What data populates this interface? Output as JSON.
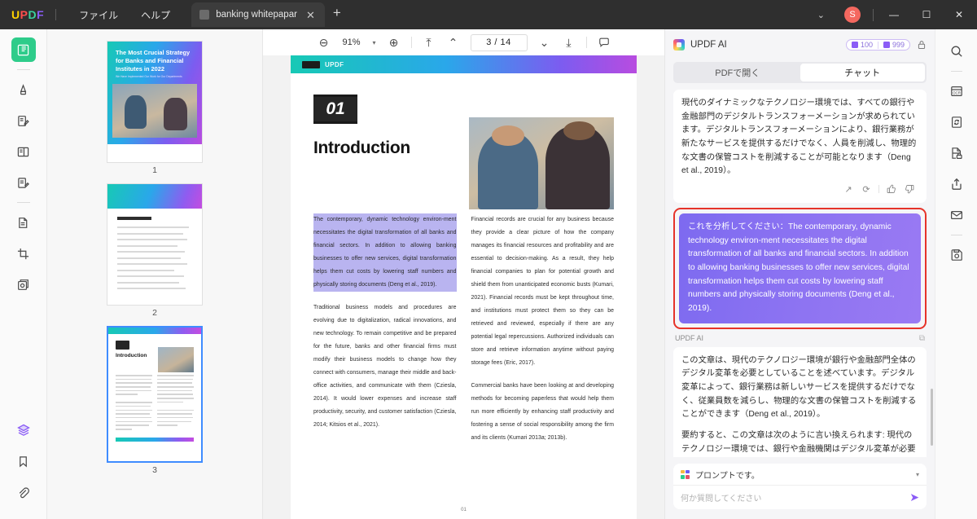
{
  "titlebar": {
    "logo": "UPDF",
    "menus": [
      "ファイル",
      "ヘルプ"
    ],
    "tab_title": "banking whitepapar",
    "tab_close": "✕",
    "new_tab": "+",
    "chevron": "⌄",
    "avatar": "S",
    "minimize": "—",
    "maximize": "☐",
    "close": "✕"
  },
  "sidebar": {
    "items": [
      {
        "name": "thumbnail-view-icon",
        "active": true
      },
      {
        "name": "highlighter-icon",
        "active": false
      },
      {
        "name": "annotate-icon",
        "active": false
      },
      {
        "name": "reading-mode-icon",
        "active": false
      },
      {
        "name": "edit-pdf-icon",
        "active": false
      },
      {
        "name": "page-organize-icon",
        "active": false
      },
      {
        "name": "crop-page-icon",
        "active": false
      },
      {
        "name": "stamp-icon",
        "active": false
      }
    ],
    "bottom_items": [
      {
        "name": "layers-icon",
        "active": true
      },
      {
        "name": "bookmark-icon",
        "active": false
      },
      {
        "name": "attachment-icon",
        "active": false
      }
    ]
  },
  "thumbnails": [
    {
      "number": "1",
      "type": "cover",
      "title": "The Most Crucial Strategy for Banks and Financial Institutes in 2022",
      "subtitle": "We Have Implemented Our Work for Our Departments",
      "selected": false
    },
    {
      "number": "2",
      "type": "toc",
      "title": "Table of Contents",
      "selected": false
    },
    {
      "number": "3",
      "type": "content",
      "title": "Introduction",
      "badge": "01",
      "selected": true
    }
  ],
  "doc_toolbar": {
    "zoom_out": "⊖",
    "zoom_level": "91%",
    "zoom_caret": "▾",
    "zoom_in": "⊕",
    "first_page": "⤒",
    "prev_page": "⌃",
    "page_indicator": "3 / 14",
    "next_page": "⌄",
    "last_page": "⤓",
    "comment": "💬"
  },
  "document": {
    "header_logo": "UPDF",
    "section_badge": "01",
    "section_title": "Introduction",
    "page_footer": "01",
    "left_column": [
      {
        "highlighted": true,
        "text": "The contemporary, dynamic technology environ-ment necessitates the digital transformation of all banks and financial sectors. In addition to allowing banking businesses to offer new services, digital transformation helps them cut costs by lowering staff numbers and physically storing documents (Deng et al., 2019)."
      },
      {
        "highlighted": false,
        "text": "Traditional business models and procedures are evolving due to digitalization, radical innovations, and new technology. To remain competitive and be prepared for the future, banks and other financial firms must modify their business models to change how they connect with consumers, manage their middle and back-office activities, and communicate with them (Cziesla, 2014). It would lower expenses and increase staff productivity, security, and customer satisfaction (Cziesla, 2014; Kitsios et al., 2021)."
      }
    ],
    "right_column": [
      {
        "highlighted": false,
        "text": "Financial records are crucial for any business because they provide a clear picture of how the company manages its financial resources and profitability and are essential to decision-making. As a result, they help financial companies to plan for potential growth and shield them from unanticipated economic busts (Kumari, 2021). Financial records must be kept throughout time, and institutions must protect them so they can be retrieved and reviewed, especially if there are any potential legal repercussions. Authorized individuals can store and retrieve information anytime without paying storage fees (Eric, 2017)."
      },
      {
        "highlighted": false,
        "text": "Commercial banks have been looking at and developing methods for becoming paperless that would help them run more efficiently by enhancing staff productivity and fostering a sense of social responsibility among the firm and its clients (Kumari 2013a; 2013b)."
      }
    ]
  },
  "ai_panel": {
    "title": "UPDF AI",
    "badge_pages": "100",
    "badge_messages": "999",
    "tabs": [
      {
        "label": "PDFで開く",
        "selected": false
      },
      {
        "label": "チャット",
        "selected": true
      }
    ],
    "messages": [
      {
        "role": "ai",
        "paragraphs": [
          "現代のダイナミックなテクノロジー環境では、すべての銀行や金融部門のデジタルトランスフォーメーションが求められています。デジタルトランスフォーメーションにより、銀行業務が新たなサービスを提供するだけでなく、人員を削減し、物理的な文書の保管コストを削減することが可能となります（Deng et al., 2019）。"
        ]
      },
      {
        "role": "user",
        "highlighted": true,
        "text": "これを分析してください：The contemporary, dynamic technology environ-ment necessitates the digital transformation of all banks and financial sectors. In addition to allowing banking businesses to offer new services, digital transformation helps them cut costs by lowering staff numbers and physically storing documents (Deng et al., 2019)."
      },
      {
        "role": "ai",
        "label": "UPDF AI",
        "paragraphs": [
          "この文章は、現代のテクノロジー環境が銀行や金融部門全体のデジタル変革を必要としていることを述べています。デジタル変革によって、銀行業務は新しいサービスを提供するだけでなく、従業員数を減らし、物理的な文書の保管コストを削減することができます（Deng et al., 2019）。",
          "要約すると、この文章は次のように言い換えられます: 現代のテクノロジー環境では、銀行や金融機関はデジタル変革が必要であり、それによって新しいサービスを提供できるだけでなく、人員を削減し、物理的な文書の保管コストも削減できると述べられています（Deng et al., 2019）。"
        ]
      }
    ],
    "actions": {
      "export": "↗",
      "regenerate": "⟳",
      "like": "👍",
      "dislike": "👎",
      "copy": "⧉"
    },
    "prompt_selector": "プロンプトです。",
    "prompt_caret": "▾",
    "input_placeholder": "何か質問してください",
    "send_icon": "➤"
  },
  "right_rail": {
    "items": [
      {
        "name": "search-icon"
      },
      {
        "name": "ocr-icon"
      },
      {
        "name": "convert-icon"
      },
      {
        "name": "protect-icon"
      },
      {
        "name": "share-icon"
      },
      {
        "name": "email-icon"
      },
      {
        "name": "save-icon"
      }
    ]
  },
  "colors": {
    "accent_purple": "#8b5cf6",
    "highlight_red": "#e63329",
    "active_green": "#2ecc8a",
    "selection_blue": "#3f8cff"
  }
}
